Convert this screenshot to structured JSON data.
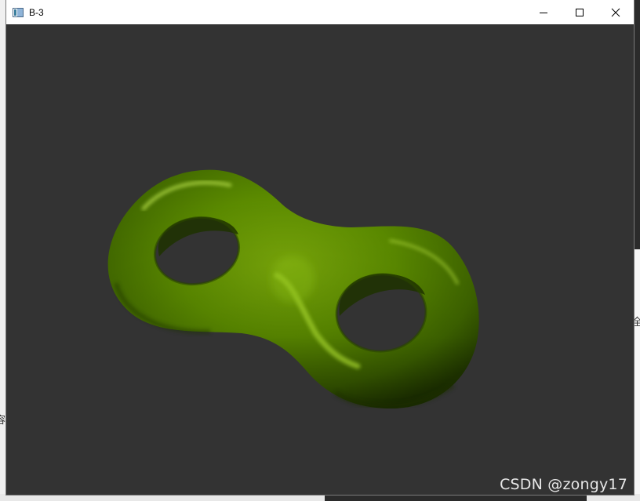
{
  "window": {
    "title": "B-3",
    "controls": {
      "minimize_icon": "minimize-icon",
      "maximize_icon": "maximize-icon",
      "close_icon": "close-icon"
    }
  },
  "viewport": {
    "background_color": "#333333",
    "model": "double-torus",
    "model_color": "#5a8a00"
  },
  "watermark": {
    "text": "CSDN @zongy17"
  },
  "background": {
    "right_char": "全。",
    "left_char": "容"
  }
}
